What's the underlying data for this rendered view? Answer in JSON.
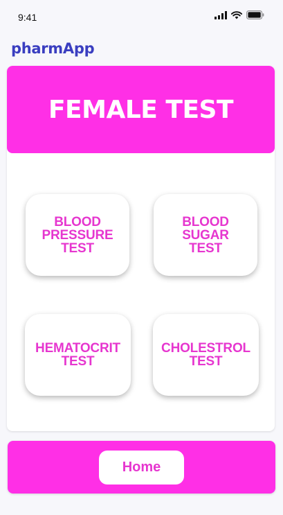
{
  "status_bar": {
    "time": "9:41",
    "icons": [
      "cellular-signal-icon",
      "wifi-icon",
      "battery-icon"
    ]
  },
  "app": {
    "title": "pharmApp"
  },
  "header": {
    "title": "FEMALE TEST"
  },
  "tests": {
    "blood_pressure": "BLOOD\nPRESSURE\nTEST",
    "blood_sugar": "BLOOD\nSUGAR\nTEST",
    "hematocrit": "HEMATOCRIT\nTEST",
    "cholesterol": "CHOLESTROL\nTEST"
  },
  "footer": {
    "home_label": "Home"
  },
  "colors": {
    "accent": "#ff2fe6",
    "label": "#e636cf",
    "brand": "#3a3ec0",
    "background": "#f7f7fb"
  }
}
